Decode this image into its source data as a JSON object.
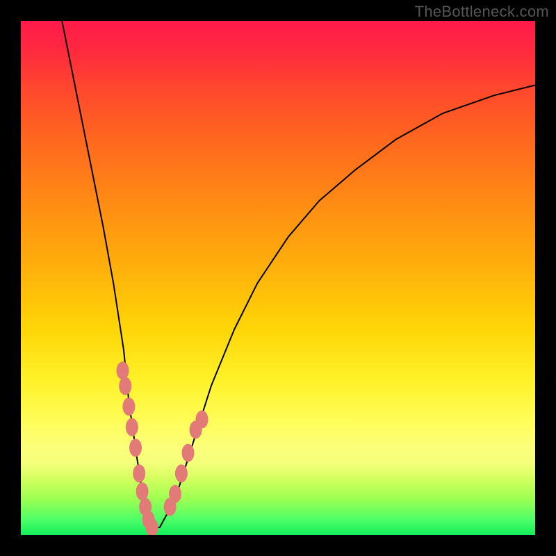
{
  "watermark": "TheBottleneck.com",
  "chart_data": {
    "type": "line",
    "title": "",
    "xlabel": "",
    "ylabel": "",
    "xlim": [
      0,
      1
    ],
    "ylim": [
      0,
      1
    ],
    "background": "rainbow-gradient-red-to-green-vertical",
    "series": [
      {
        "name": "curve",
        "description": "Black V-shaped curve; steep left arm, shallower right arm approaching top-right.",
        "x": [
          0.08,
          0.1,
          0.12,
          0.14,
          0.16,
          0.18,
          0.2,
          0.21,
          0.225,
          0.24,
          0.255,
          0.27,
          0.3,
          0.335,
          0.37,
          0.415,
          0.46,
          0.52,
          0.58,
          0.65,
          0.73,
          0.82,
          0.92,
          1.0
        ],
        "y": [
          1.0,
          0.9,
          0.8,
          0.7,
          0.6,
          0.49,
          0.36,
          0.26,
          0.155,
          0.06,
          0.015,
          0.015,
          0.07,
          0.18,
          0.29,
          0.4,
          0.49,
          0.58,
          0.65,
          0.71,
          0.77,
          0.82,
          0.855,
          0.875
        ]
      },
      {
        "name": "dots-left-arm",
        "type": "scatter",
        "color": "#e27a78",
        "x": [
          0.198,
          0.203,
          0.21,
          0.216,
          0.223,
          0.23,
          0.236,
          0.242,
          0.248,
          0.255
        ],
        "y": [
          0.32,
          0.29,
          0.25,
          0.21,
          0.17,
          0.12,
          0.085,
          0.055,
          0.03,
          0.015
        ]
      },
      {
        "name": "dots-right-arm",
        "type": "scatter",
        "color": "#e27a78",
        "x": [
          0.29,
          0.3,
          0.312,
          0.325,
          0.34,
          0.352
        ],
        "y": [
          0.055,
          0.08,
          0.12,
          0.16,
          0.205,
          0.225
        ]
      }
    ]
  }
}
